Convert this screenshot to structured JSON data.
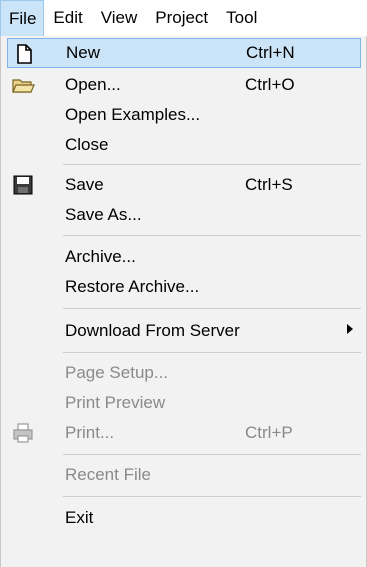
{
  "menubar": {
    "items": [
      "File",
      "Edit",
      "View",
      "Project",
      "Tool"
    ]
  },
  "file_menu": {
    "new": {
      "label": "New",
      "shortcut": "Ctrl+N"
    },
    "open": {
      "label": "Open...",
      "shortcut": "Ctrl+O"
    },
    "open_examples": {
      "label": "Open Examples..."
    },
    "close": {
      "label": "Close"
    },
    "save": {
      "label": "Save",
      "shortcut": "Ctrl+S"
    },
    "save_as": {
      "label": "Save As..."
    },
    "archive": {
      "label": "Archive..."
    },
    "restore_archive": {
      "label": "Restore Archive..."
    },
    "download_from_server": {
      "label": "Download From Server"
    },
    "page_setup": {
      "label": "Page Setup..."
    },
    "print_preview": {
      "label": "Print Preview"
    },
    "print": {
      "label": "Print...",
      "shortcut": "Ctrl+P"
    },
    "recent_file": {
      "label": "Recent File"
    },
    "exit": {
      "label": "Exit"
    }
  },
  "icons": {
    "new": "new-document-icon",
    "open": "open-folder-icon",
    "save": "floppy-disk-icon",
    "print": "printer-icon",
    "submenu": "chevron-right-icon"
  },
  "colors": {
    "highlight": "#cce4f7",
    "highlight_border": "#7eb4ea",
    "menu_background": "#f2f2f2",
    "disabled_text": "#8a8a8a"
  }
}
